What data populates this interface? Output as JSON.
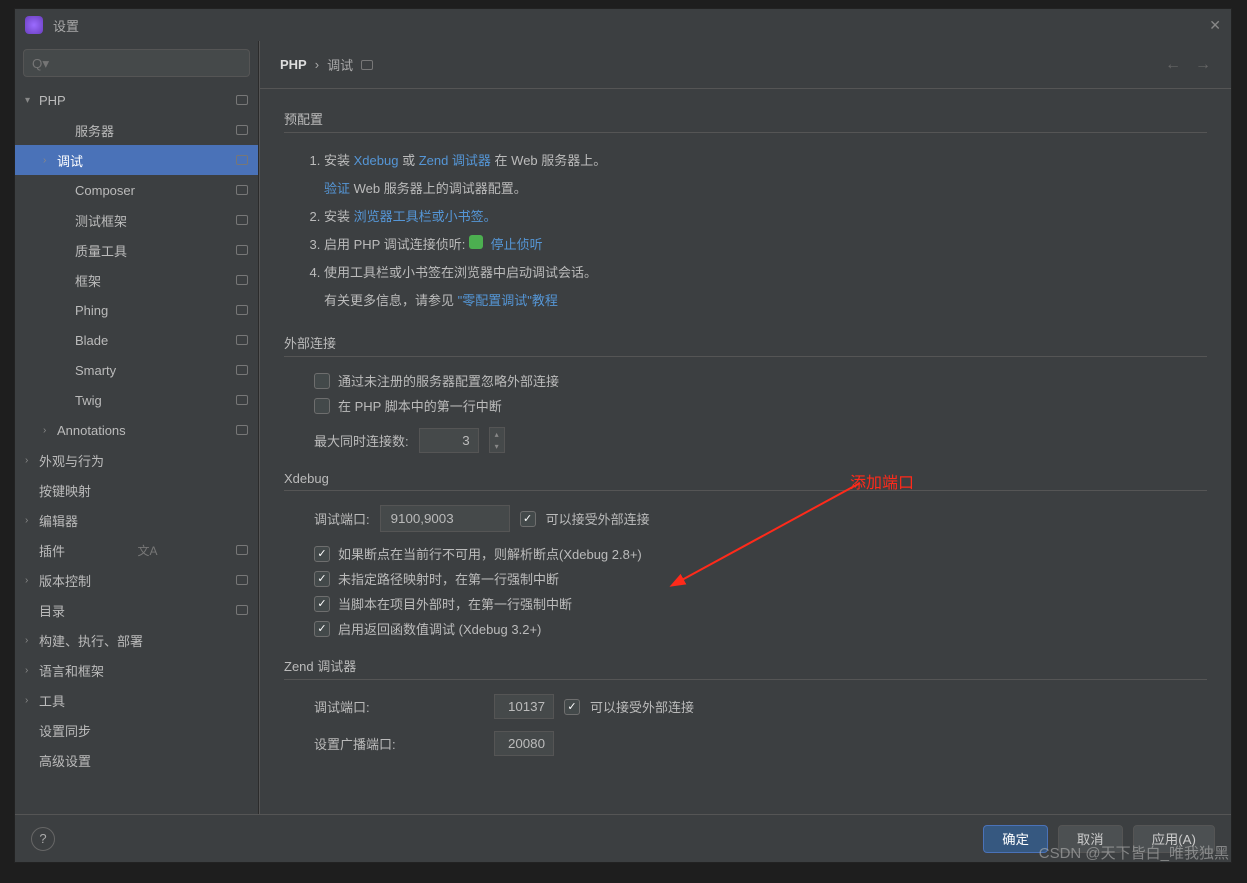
{
  "window": {
    "title": "设置"
  },
  "search": {
    "placeholder": "Q▾"
  },
  "breadcrumb": {
    "root": "PHP",
    "sep": "›",
    "leaf": "调试"
  },
  "nav": {
    "back": "←",
    "forward": "→"
  },
  "tree": [
    {
      "label": "PHP",
      "depth": 0,
      "arrow": "▾",
      "badge": true
    },
    {
      "label": "服务器",
      "depth": 2,
      "badge": true
    },
    {
      "label": "调试",
      "depth": 1,
      "arrow": "›",
      "badge": true,
      "selected": true
    },
    {
      "label": "Composer",
      "depth": 2,
      "badge": true
    },
    {
      "label": "测试框架",
      "depth": 2,
      "badge": true
    },
    {
      "label": "质量工具",
      "depth": 2,
      "badge": true
    },
    {
      "label": "框架",
      "depth": 2,
      "badge": true
    },
    {
      "label": "Phing",
      "depth": 2,
      "badge": true
    },
    {
      "label": "Blade",
      "depth": 2,
      "badge": true
    },
    {
      "label": "Smarty",
      "depth": 2,
      "badge": true
    },
    {
      "label": "Twig",
      "depth": 2,
      "badge": true
    },
    {
      "label": "Annotations",
      "depth": 1,
      "arrow": "›",
      "badge": true
    },
    {
      "label": "外观与行为",
      "depth": 0,
      "arrow": "›"
    },
    {
      "label": "按键映射",
      "depth": 0
    },
    {
      "label": "编辑器",
      "depth": 0,
      "arrow": "›"
    },
    {
      "label": "插件",
      "depth": 0,
      "lang": true,
      "badge": true
    },
    {
      "label": "版本控制",
      "depth": 0,
      "arrow": "›",
      "badge": true
    },
    {
      "label": "目录",
      "depth": 0,
      "badge": true
    },
    {
      "label": "构建、执行、部署",
      "depth": 0,
      "arrow": "›"
    },
    {
      "label": "语言和框架",
      "depth": 0,
      "arrow": "›"
    },
    {
      "label": "工具",
      "depth": 0,
      "arrow": "›"
    },
    {
      "label": "设置同步",
      "depth": 0
    },
    {
      "label": "高级设置",
      "depth": 0
    }
  ],
  "preconfig": {
    "title": "预配置",
    "step1a": "安装 ",
    "step1_xdebug": "Xdebug",
    "step1_or": " 或 ",
    "step1_zend": "Zend 调试器",
    "step1b": " 在 Web 服务器上。",
    "step1_verify": "验证",
    "step1_verify_b": " Web 服务器上的调试器配置。",
    "step2a": "安装 ",
    "step2_link": "浏览器工具栏或小书签。",
    "step3a": "启用 PHP 调试连接侦听: ",
    "step3_link": " 停止侦听",
    "step4a": "使用工具栏或小书签在浏览器中启动调试会话。",
    "step4b": "有关更多信息，请参见 ",
    "step4_link": "\"零配置调试\"教程"
  },
  "external": {
    "title": "外部连接",
    "chk1": "通过未注册的服务器配置忽略外部连接",
    "chk2": "在 PHP 脚本中的第一行中断",
    "maxconn_label": "最大同时连接数:",
    "maxconn_value": "3"
  },
  "xdebug": {
    "title": "Xdebug",
    "port_label": "调试端口:",
    "port_value": "9100,9003",
    "accept_ext": "可以接受外部连接",
    "chk1": "如果断点在当前行不可用，则解析断点(Xdebug 2.8+)",
    "chk2": "未指定路径映射时，在第一行强制中断",
    "chk3": "当脚本在项目外部时，在第一行强制中断",
    "chk4": "启用返回函数值调试 (Xdebug 3.2+)"
  },
  "zend": {
    "title": "Zend 调试器",
    "port_label": "调试端口:",
    "port_value": "10137",
    "accept_ext": "可以接受外部连接",
    "broadcast_label": "设置广播端口:",
    "broadcast_value": "20080"
  },
  "annotation": {
    "label": "添加端口"
  },
  "footer": {
    "help": "?",
    "ok": "确定",
    "cancel": "取消",
    "apply": "应用(A)"
  },
  "watermark": "CSDN @天下皆白_唯我独黑"
}
